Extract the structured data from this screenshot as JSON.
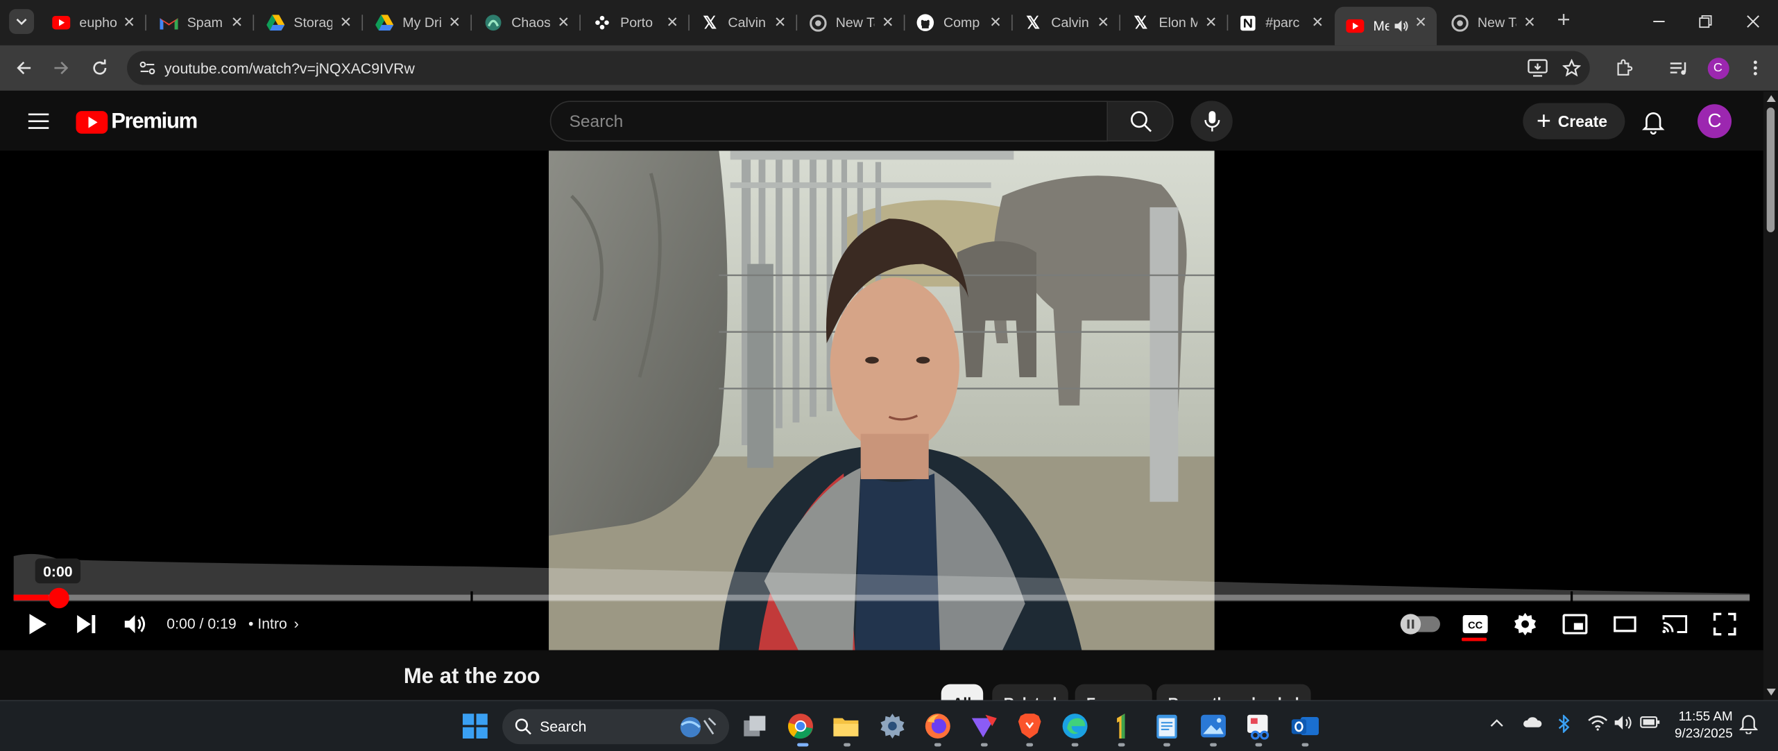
{
  "browser": {
    "tabs": [
      {
        "title": "euphoria",
        "favicon": "youtube-icon"
      },
      {
        "title": "Spam",
        "favicon": "gmail-icon"
      },
      {
        "title": "Storage",
        "favicon": "drive-icon"
      },
      {
        "title": "My Drive",
        "favicon": "drive-icon"
      },
      {
        "title": "Chaos",
        "favicon": "chaos-icon"
      },
      {
        "title": "Porto",
        "favicon": "porto-icon"
      },
      {
        "title": "Calvin",
        "favicon": "x-icon"
      },
      {
        "title": "New Tab",
        "favicon": "chrome-icon"
      },
      {
        "title": "Comp",
        "favicon": "github-icon"
      },
      {
        "title": "Calvin",
        "favicon": "x-icon"
      },
      {
        "title": "Elon M",
        "favicon": "x-icon"
      },
      {
        "title": "#parc",
        "favicon": "notion-icon"
      },
      {
        "title": "Me",
        "favicon": "youtube-icon",
        "active": true,
        "audio": true
      },
      {
        "title": "New Tab",
        "favicon": "chrome-icon"
      }
    ],
    "url": "youtube.com/watch?v=jNQXAC9IVRw",
    "profile_initial": "C"
  },
  "youtube": {
    "logo_text": "Premium",
    "search_placeholder": "Search",
    "create_label": "Create",
    "avatar_initial": "C"
  },
  "player": {
    "tooltip_time": "0:00",
    "time_display": "0:00 / 0:19",
    "chapter": "Intro",
    "progress_fraction": 0.02,
    "chapter_marks_fraction": [
      0.263,
      0.898
    ],
    "captions_on": true
  },
  "video": {
    "title": "Me at the zoo",
    "chips": [
      {
        "label": "All",
        "active": true
      },
      {
        "label": "Related",
        "active": false
      },
      {
        "label": "For you",
        "active": false
      },
      {
        "label": "Recently uploaded",
        "active": false
      }
    ]
  },
  "taskbar": {
    "search_label": "Search",
    "time": "11:55 AM",
    "date": "9/23/2025",
    "apps": [
      "windows-start-icon",
      "search-icon",
      "task-view-icon",
      "chrome-icon",
      "file-explorer-icon",
      "settings-icon",
      "firefox-icon",
      "vivaldi-icon",
      "brave-icon",
      "edge-icon",
      "app-1-icon",
      "notepad-icon",
      "photos-icon",
      "snipping-tool-icon",
      "outlook-icon"
    ]
  },
  "colors": {
    "youtube_red": "#ff0000",
    "background": "#0f0f0f",
    "avatar": "#9c27b0"
  }
}
